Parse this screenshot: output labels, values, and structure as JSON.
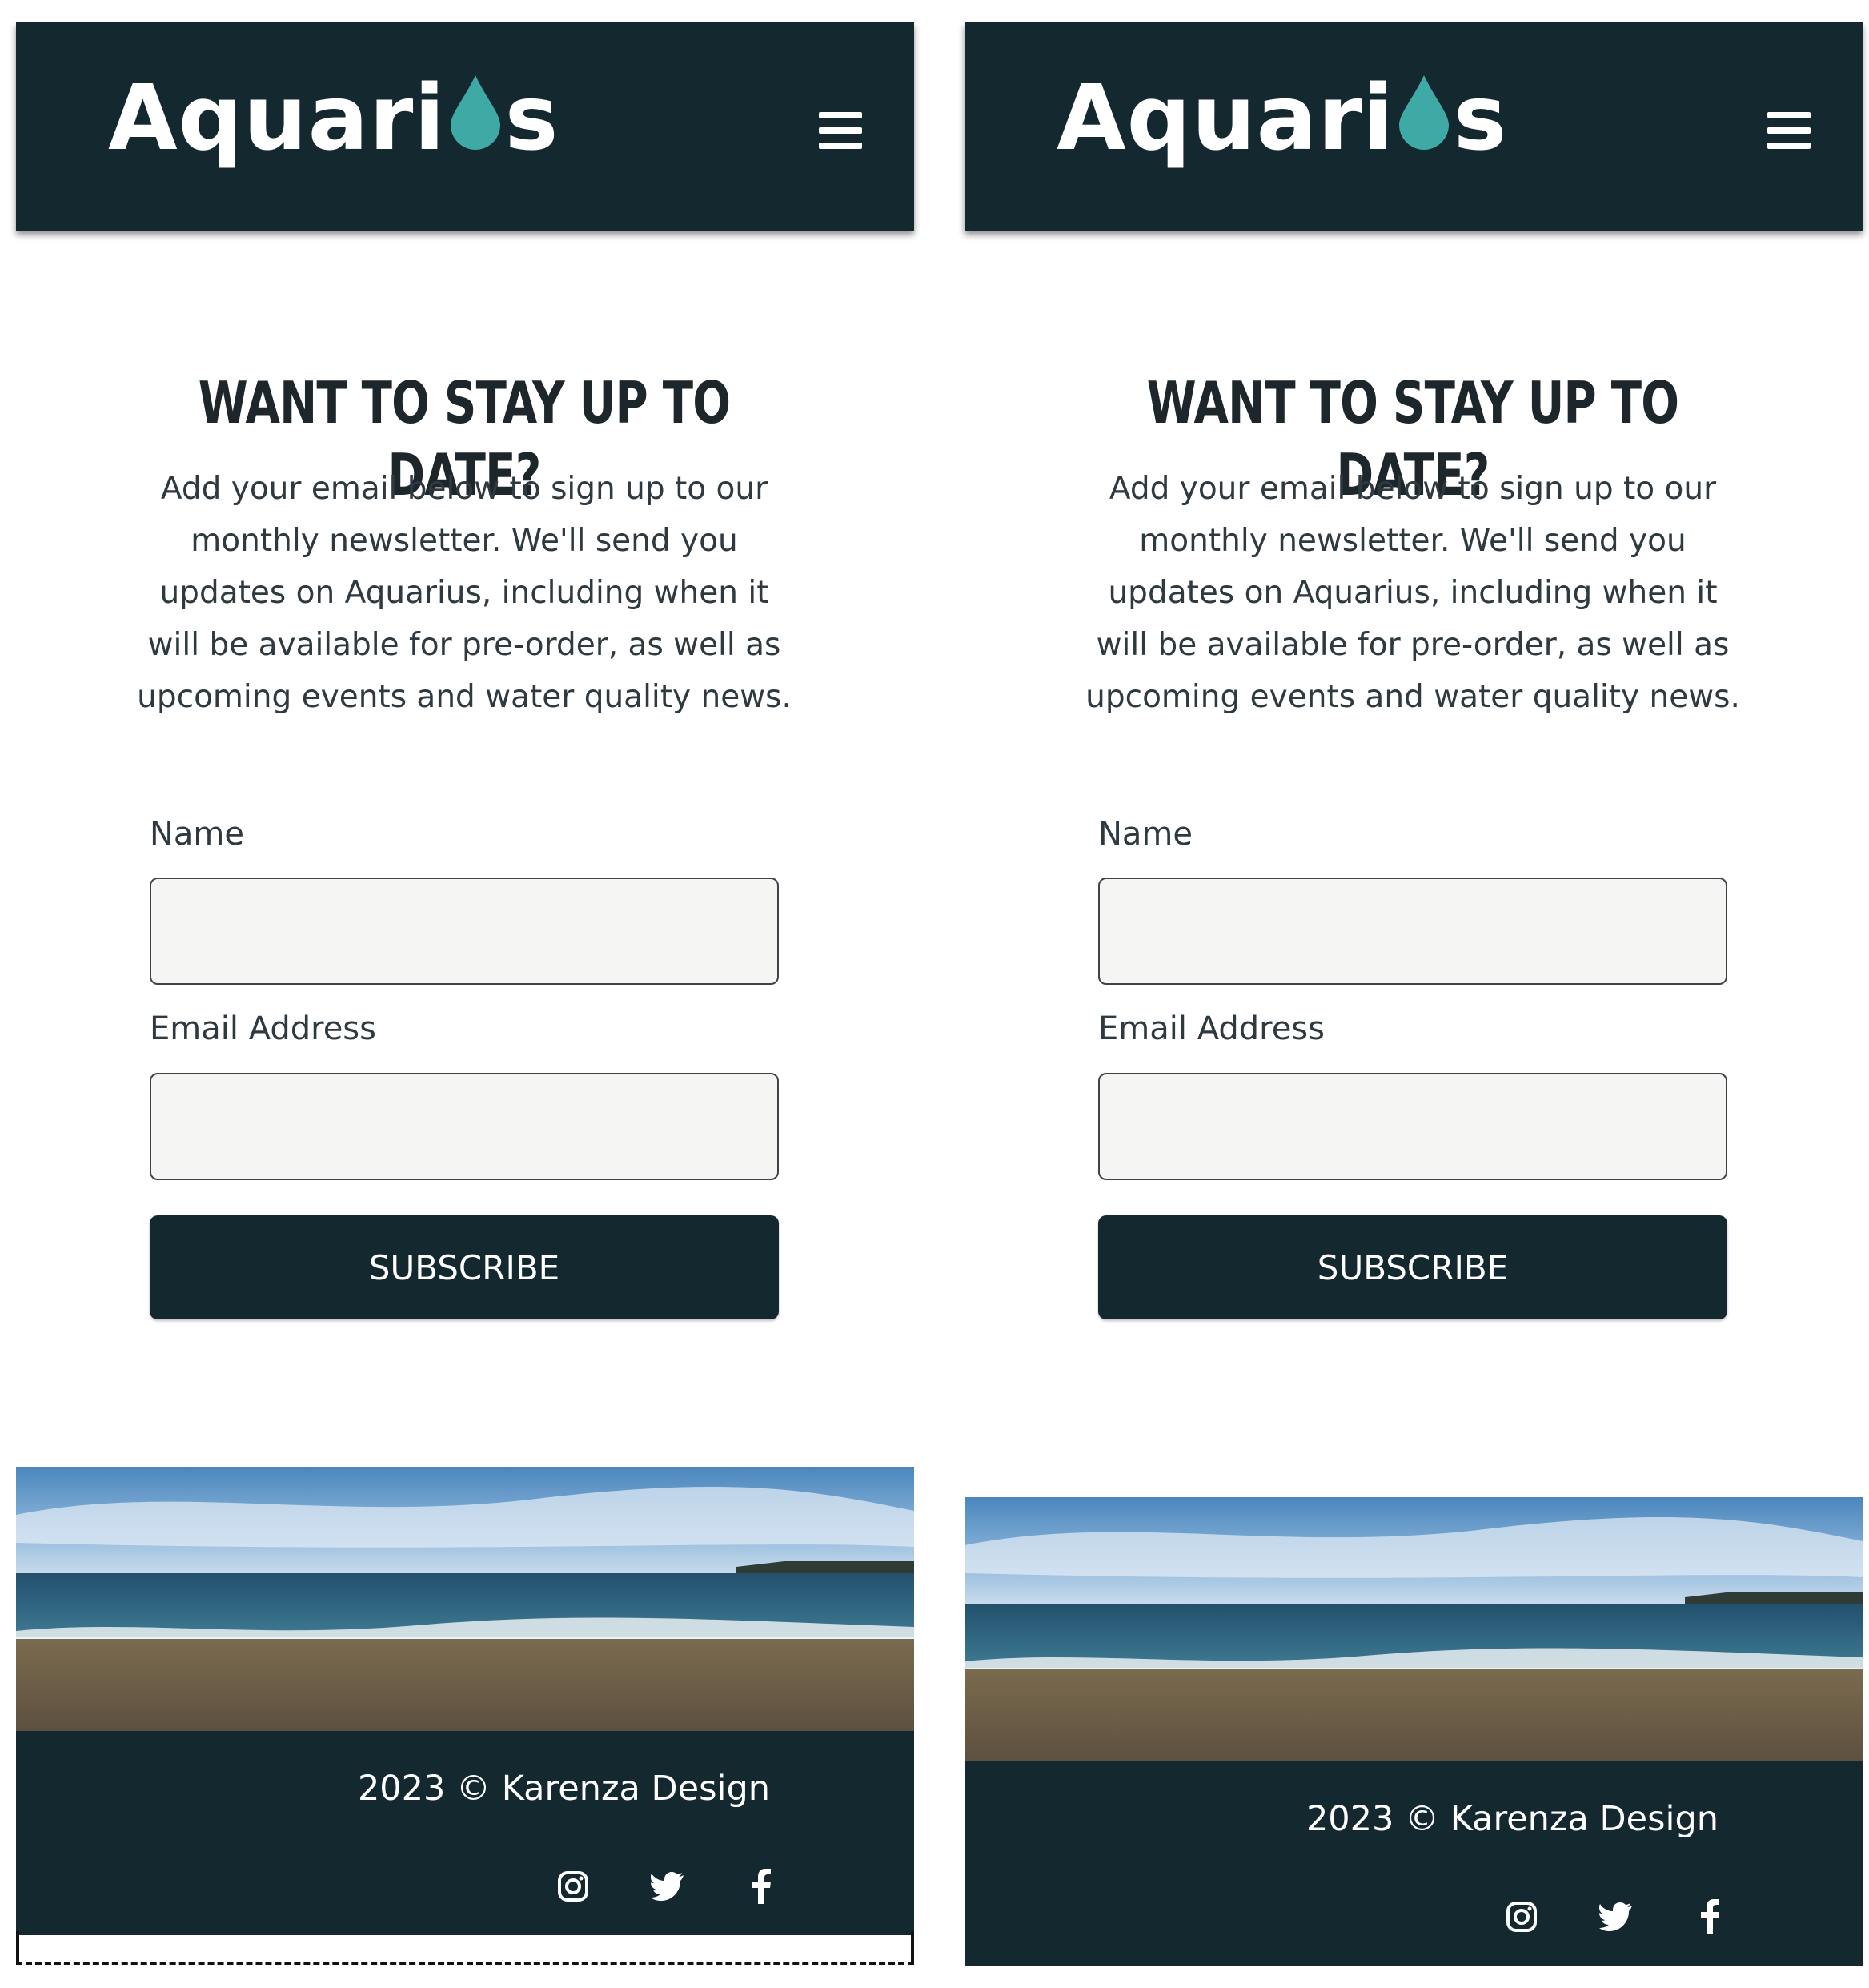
{
  "header": {
    "logo_text_before": "Aquari",
    "logo_text_after": "s",
    "logo_drop_color": "#3fa9a5",
    "menu_icon": "hamburger-menu-icon",
    "background_color": "#14282f"
  },
  "newsletter": {
    "title": "WANT TO STAY UP TO DATE?",
    "description": "Add your email below to sign up to our monthly newsletter. We'll send you updates on Aquarius, including when it will be available for pre-order, as well as upcoming events and water quality news.",
    "name_label": "Name",
    "name_value": "",
    "email_label": "Email Address",
    "email_value": "",
    "subscribe_label": "SUBSCRIBE"
  },
  "footer": {
    "copyright": "2023 © Karenza Design",
    "social_icons": [
      "instagram-icon",
      "twitter-icon",
      "facebook-icon"
    ],
    "background_color": "#14282f"
  }
}
